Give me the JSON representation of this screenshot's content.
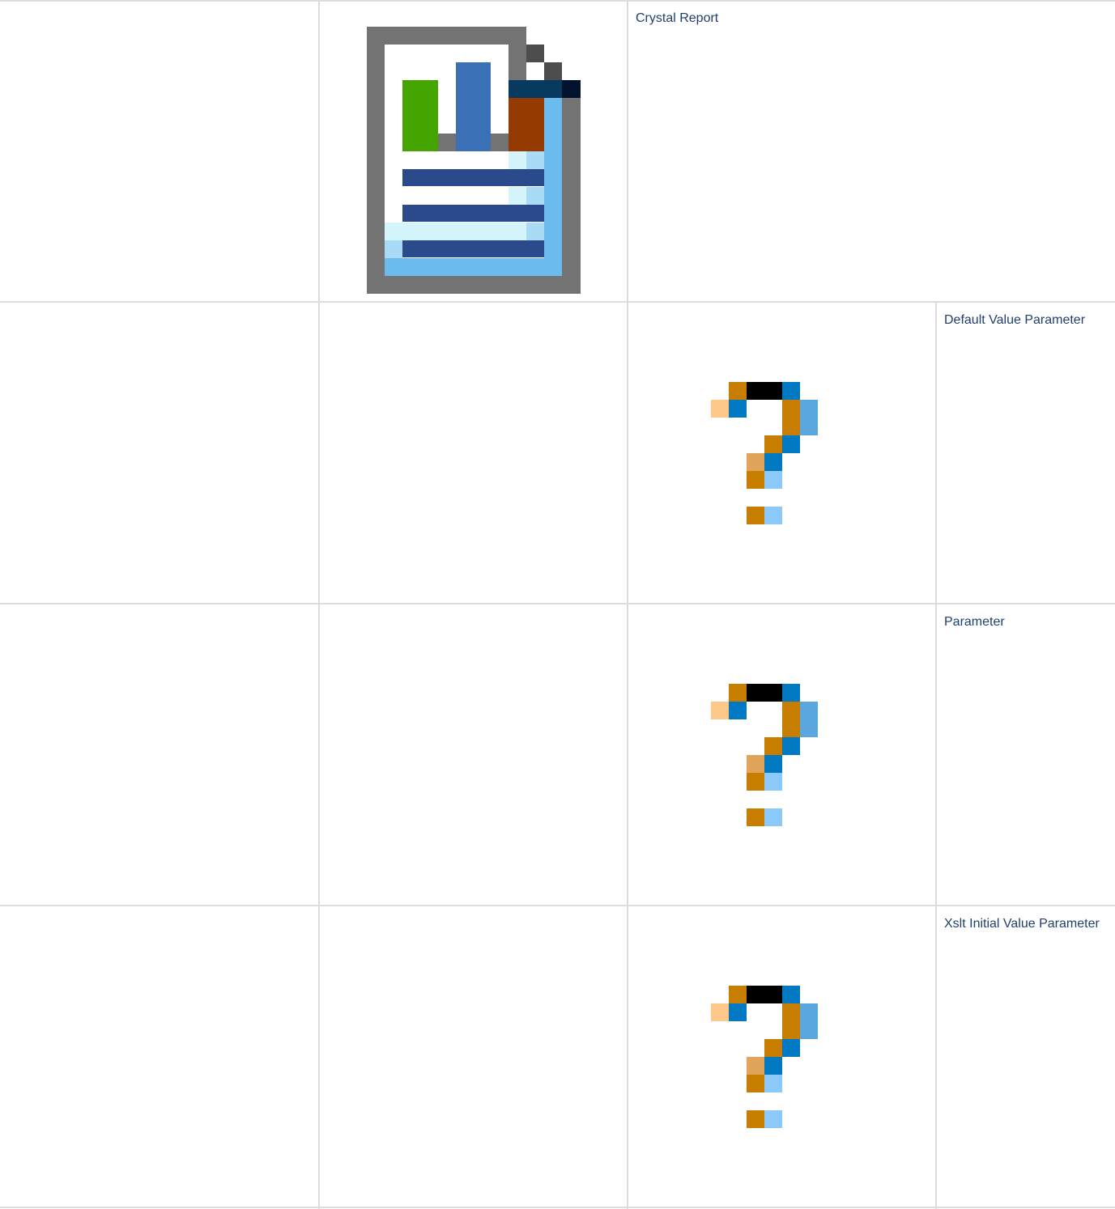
{
  "rows": [
    {
      "label": "Crystal Report",
      "icon": "crystal-report-icon"
    },
    {
      "label": "Default Value Parameter",
      "icon": "question-mark-icon"
    },
    {
      "label": "Parameter",
      "icon": "question-mark-icon"
    },
    {
      "label": "Xslt Initial Value Parameter",
      "icon": "question-mark-icon"
    }
  ],
  "colors": {
    "grid_line": "#dcdcdc",
    "label_text": "#1f3f6e",
    "report_frame": "#737373",
    "report_bar_green": "#45a500",
    "report_bar_blue": "#3a70b5",
    "report_bar_brown": "#953a00",
    "report_lines": "#2a4a8c",
    "report_accent": "#6bbcec",
    "question_orange": "#c77e00",
    "question_blue": "#0079c2",
    "question_black": "#000000"
  }
}
